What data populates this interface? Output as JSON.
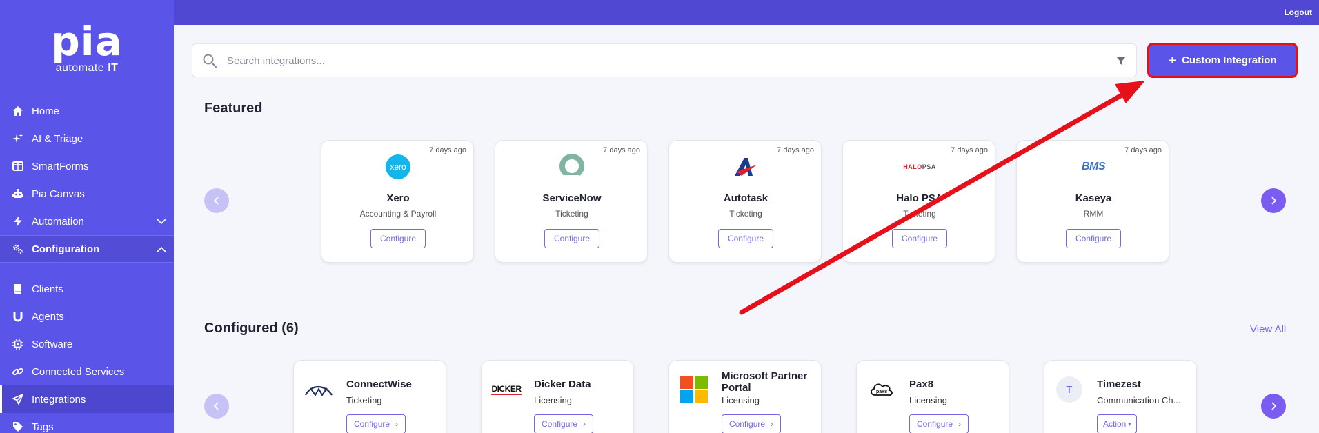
{
  "brand": {
    "word": "pia",
    "tagline_prefix": "automate ",
    "tagline_bold": "IT"
  },
  "topbar": {
    "logout": "Logout"
  },
  "sidebar": {
    "items": [
      {
        "label": "Home",
        "icon": "home-icon"
      },
      {
        "label": "AI & Triage",
        "icon": "sparkle-icon"
      },
      {
        "label": "SmartForms",
        "icon": "form-icon"
      },
      {
        "label": "Pia Canvas",
        "icon": "robot-icon"
      },
      {
        "label": "Automation",
        "icon": "bolt-icon"
      },
      {
        "label": "Configuration",
        "icon": "cogs-icon"
      },
      {
        "label": "Clients",
        "icon": "book-icon"
      },
      {
        "label": "Agents",
        "icon": "magnet-icon"
      },
      {
        "label": "Software",
        "icon": "chip-icon"
      },
      {
        "label": "Connected Services",
        "icon": "link-icon"
      },
      {
        "label": "Integrations",
        "icon": "send-icon"
      },
      {
        "label": "Tags",
        "icon": "tag-icon"
      }
    ]
  },
  "search": {
    "placeholder": "Search integrations..."
  },
  "custom_button": {
    "label": "Custom Integration"
  },
  "featured": {
    "title": "Featured",
    "cards": [
      {
        "name": "Xero",
        "category": "Accounting & Payroll",
        "time": "7 days ago",
        "action": "Configure",
        "logo": "xero"
      },
      {
        "name": "ServiceNow",
        "category": "Ticketing",
        "time": "7 days ago",
        "action": "Configure",
        "logo": "servicenow"
      },
      {
        "name": "Autotask",
        "category": "Ticketing",
        "time": "7 days ago",
        "action": "Configure",
        "logo": "autotask"
      },
      {
        "name": "Halo PSA",
        "category": "Ticketing",
        "time": "7 days ago",
        "action": "Configure",
        "logo": "halopsa"
      },
      {
        "name": "Kaseya",
        "category": "RMM",
        "time": "7 days ago",
        "action": "Configure",
        "logo": "bms"
      }
    ]
  },
  "configured": {
    "title": "Configured (6)",
    "view_all": "View All",
    "cards": [
      {
        "name": "ConnectWise",
        "category": "Ticketing",
        "action": "Configure",
        "logo": "connectwise"
      },
      {
        "name": "Dicker Data",
        "category": "Licensing",
        "action": "Configure",
        "logo": "dicker"
      },
      {
        "name": "Microsoft Partner Portal",
        "category": "Licensing",
        "action": "Configure",
        "logo": "microsoft"
      },
      {
        "name": "Pax8",
        "category": "Licensing",
        "action": "Configure",
        "logo": "pax8"
      },
      {
        "name": "Timezest",
        "category": "Communication Ch...",
        "action": "Action",
        "logo": "timezest",
        "avatar_letter": "T"
      }
    ]
  },
  "logo_text": {
    "xero": "xero",
    "halopsa_a": "HALO",
    "halopsa_b": "PSA",
    "bms": "BMS",
    "dicker": "DICKER",
    "pax8": "pax8"
  },
  "colors": {
    "sidebar": "#5b54e8",
    "accent": "#6f69e6",
    "annotation": "#e5101a"
  }
}
